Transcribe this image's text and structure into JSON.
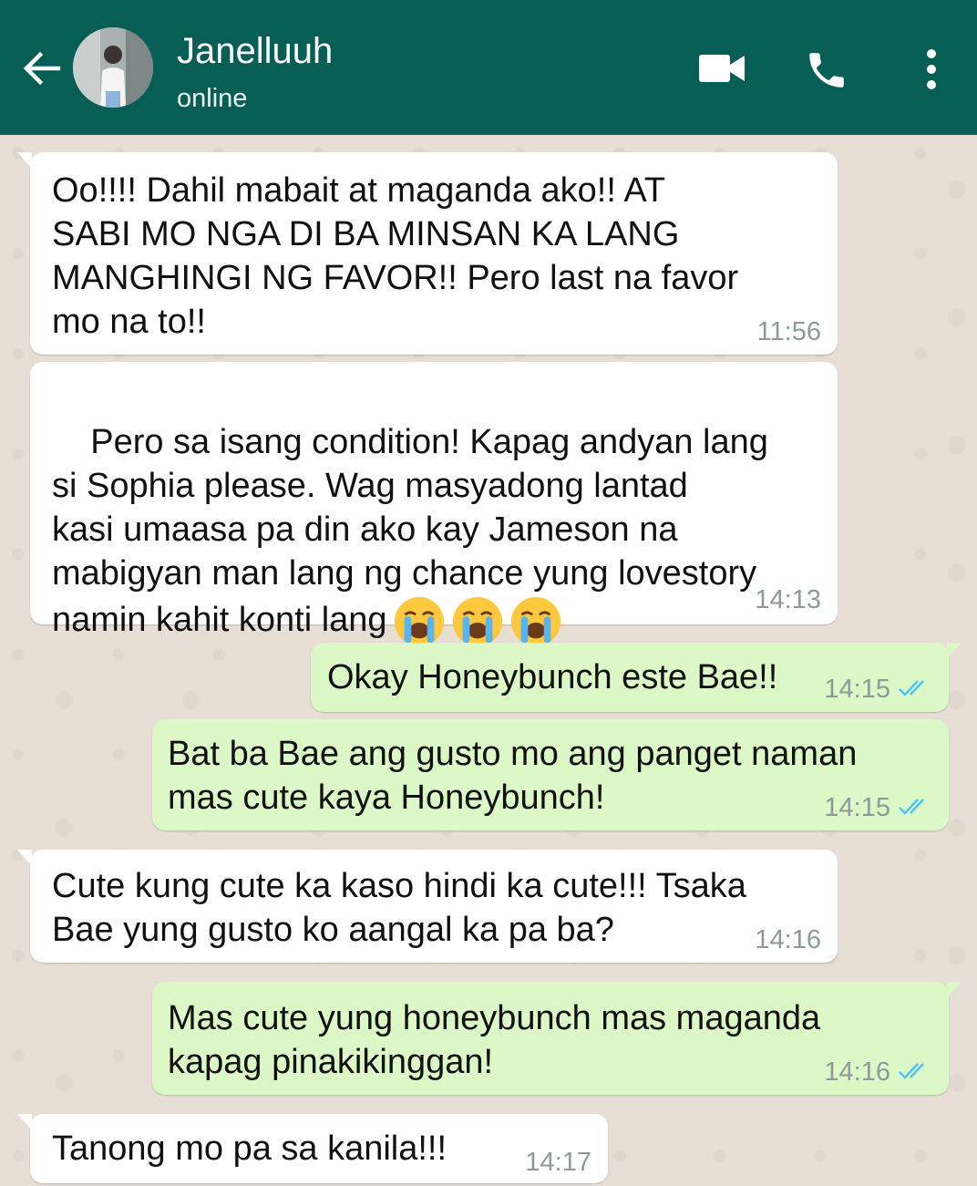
{
  "header": {
    "contact_name": "Janelluuh",
    "status": "online"
  },
  "colors": {
    "header": "#075e54",
    "outgoing_bubble": "#dcf8c6",
    "incoming_bubble": "#ffffff",
    "read_ticks": "#4fc3f7"
  },
  "messages": [
    {
      "direction": "in",
      "text": "Oo!!!! Dahil mabait at maganda ako!! AT\nSABI MO NGA DI BA MINSAN KA LANG\nMANGHINGI NG FAVOR!! Pero last na favor\nmo na to!!",
      "time": "11:56"
    },
    {
      "direction": "in",
      "text": "Pero sa isang condition! Kapag andyan lang\nsi Sophia please. Wag masyadong lantad\nkasi umaasa pa din ako kay Jameson na\nmabigyan man lang ng chance yung lovestory\nnamin kahit konti lang",
      "emoji": "loudly-crying-face x3",
      "time": "14:13"
    },
    {
      "direction": "out",
      "text": "Okay Honeybunch este Bae!!",
      "time": "14:15",
      "read": true
    },
    {
      "direction": "out",
      "text": "Bat ba Bae ang gusto mo ang panget naman\nmas cute kaya Honeybunch!",
      "time": "14:15",
      "read": true
    },
    {
      "direction": "in",
      "text": "Cute kung cute ka kaso hindi ka cute!!! Tsaka\nBae yung gusto ko aangal ka pa ba?",
      "time": "14:16"
    },
    {
      "direction": "out",
      "text": "Mas cute yung honeybunch mas maganda\nkapag pinakikinggan!",
      "time": "14:16",
      "read": true
    },
    {
      "direction": "in",
      "text": "Tanong mo pa sa kanila!!!",
      "time": "14:17"
    }
  ]
}
